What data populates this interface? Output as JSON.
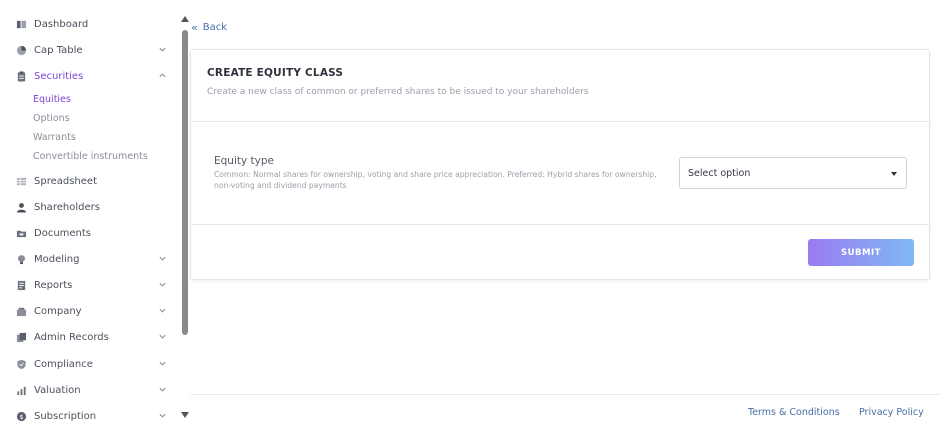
{
  "sidebar": {
    "items": [
      {
        "label": "Dashboard",
        "icon": "dashboard-icon"
      },
      {
        "label": "Cap Table",
        "icon": "pie-chart-icon"
      },
      {
        "label": "Securities",
        "icon": "clipboard-icon"
      },
      {
        "label": "Spreadsheet",
        "icon": "spreadsheet-icon"
      },
      {
        "label": "Shareholders",
        "icon": "user-icon"
      },
      {
        "label": "Documents",
        "icon": "folder-icon"
      },
      {
        "label": "Modeling",
        "icon": "lightbulb-icon"
      },
      {
        "label": "Reports",
        "icon": "report-icon"
      },
      {
        "label": "Company",
        "icon": "building-icon"
      },
      {
        "label": "Admin Records",
        "icon": "records-icon"
      },
      {
        "label": "Compliance",
        "icon": "shield-icon"
      },
      {
        "label": "Valuation",
        "icon": "valuation-icon"
      },
      {
        "label": "Subscription",
        "icon": "dollar-icon"
      }
    ],
    "securities_sub": [
      "Equities",
      "Options",
      "Warrants",
      "Convertible instruments"
    ],
    "active_item": "Securities",
    "active_sub": "Equities"
  },
  "back_label": "Back",
  "form": {
    "title": "CREATE EQUITY CLASS",
    "subtitle": "Create a new class of common or preferred shares to be issued to your shareholders",
    "equity_type_label": "Equity type",
    "equity_type_help": "Common: Normal shares for ownership, voting and share price appreciation. Preferred: Hybrid shares for ownership, non-voting and dividend payments",
    "select_value": "Select option",
    "submit_label": "SUBMIT"
  },
  "footer": {
    "terms": "Terms & Conditions",
    "privacy": "Privacy Policy"
  },
  "colors": {
    "accent": "#7a45d6",
    "link": "#4a6fa5",
    "submit_gradient_start": "#9a7bf0",
    "submit_gradient_end": "#7fb8f5"
  }
}
